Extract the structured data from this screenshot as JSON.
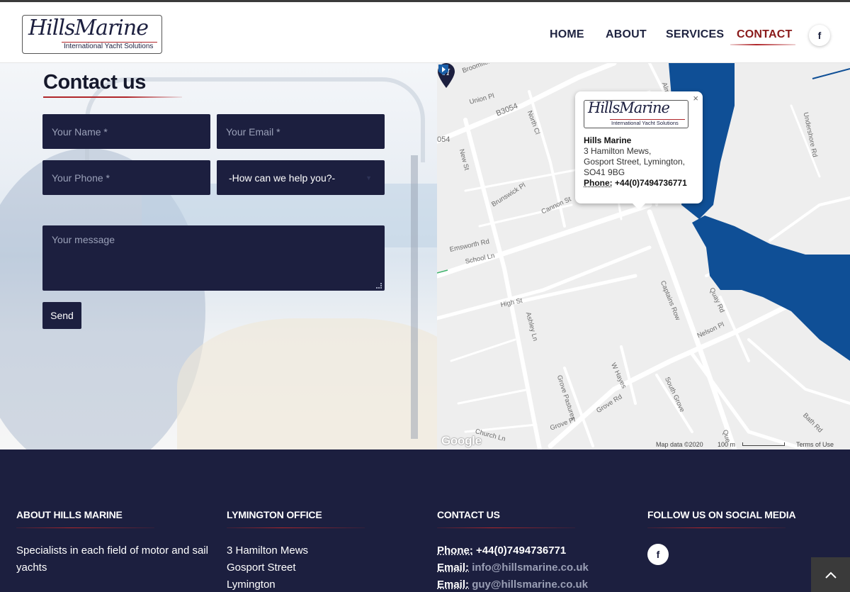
{
  "header": {
    "logo": {
      "script": "HillsMarine",
      "tagline": "International Yacht Solutions"
    },
    "nav": [
      {
        "label": "HOME",
        "active": false
      },
      {
        "label": "ABOUT",
        "active": false
      },
      {
        "label": "SERVICES",
        "active": false
      },
      {
        "label": "CONTACT",
        "active": true
      }
    ],
    "social_icon": "facebook-icon",
    "social_glyph": "f"
  },
  "contact": {
    "title": "Contact us",
    "fields": {
      "name_placeholder": "Your Name *",
      "email_placeholder": "Your Email *",
      "phone_placeholder": "Your Phone *",
      "help_selected": "-How can we help you?-",
      "message_placeholder": "Your message"
    },
    "send_label": "Send"
  },
  "map": {
    "popup": {
      "logo_script": "HillsMarine",
      "logo_tagline": "International Yacht Solutions",
      "name": "Hills Marine",
      "address_lines": [
        "3 Hamilton Mews,",
        "Gosport Street, Lymington,",
        "SO41 9BG"
      ],
      "phone_label": "Phone:",
      "phone_value": "+44(0)7494736771",
      "close": "×"
    },
    "streets": {
      "broomfield": "Broomfield Ln",
      "union": "Union Pl",
      "b3054": "B3054",
      "north_cl": "North Cl",
      "n054": "054",
      "new_st": "New St",
      "brunswick": "Brunswick Pl",
      "cannon": "Cannon St",
      "emsworth": "Emsworth Rd",
      "school": "School Ln",
      "high": "High St",
      "ashley": "Ashley Ln",
      "captains": "Captains Row",
      "quay": "Quay Rd",
      "nelson": "Nelson Pl",
      "whayes": "W Hayes",
      "grove_pastures": "Grove Pastures",
      "grove_rd": "Grove Rd",
      "grove_pl": "Grove Pl",
      "church": "Church Ln",
      "south_grove": "South Grove",
      "bath": "Bath Rd",
      "undershore": "Undershore Rd",
      "alma": "Alma",
      "que": "Que"
    },
    "google": "Google",
    "map_data": "Map data ©2020",
    "scale": "100 m",
    "terms": "Terms of Use",
    "water_color": "#0f4f96"
  },
  "footer": {
    "about": {
      "heading": "ABOUT HILLS MARINE",
      "lines": [
        "Specialists in each field of motor and sail",
        "yachts"
      ]
    },
    "office": {
      "heading": "LYMINGTON OFFICE",
      "lines": [
        "3 Hamilton Mews",
        "Gosport Street",
        "Lymington"
      ]
    },
    "contact": {
      "heading": "CONTACT US",
      "phone_label": "Phone:",
      "phone_value": "+44(0)7494736771",
      "email_label": "Email:",
      "email1": "info@hillsmarine.co.uk",
      "email2": "guy@hillsmarine.co.uk"
    },
    "social": {
      "heading": "FOLLOW US ON SOCIAL MEDIA",
      "icon": "facebook-icon",
      "glyph": "f"
    }
  },
  "colors": {
    "navy": "#1c1f3f",
    "accent_red": "#b0262a",
    "active_nav": "#8a1a1a"
  }
}
